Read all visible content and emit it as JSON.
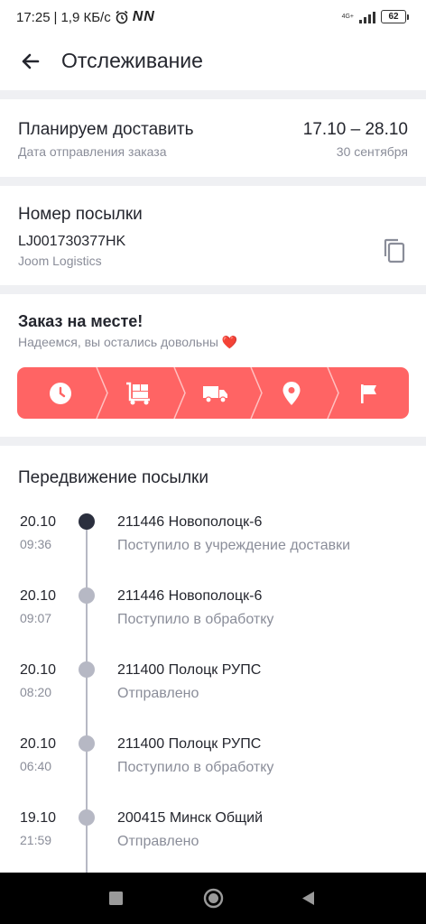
{
  "status_bar": {
    "time": "17:25",
    "speed": "1,9 КБ/с",
    "carrier_badge": "NN",
    "network": "4G+",
    "battery": "62",
    "icons": [
      "alarm-icon",
      "signal-icon",
      "battery-icon"
    ]
  },
  "header": {
    "title": "Отслеживание",
    "back_icon": "arrow-left-icon"
  },
  "delivery": {
    "label": "Планируем доставить",
    "sub_label": "Дата отправления заказа",
    "dates": "17.10 – 28.10",
    "sent_date": "30 сентября"
  },
  "parcel": {
    "label": "Номер посылки",
    "number": "LJ001730377HK",
    "carrier": "Joom Logistics",
    "copy_icon": "copy-icon"
  },
  "order_status": {
    "title": "Заказ на месте!",
    "subtitle": "Надеемся, вы остались довольны ❤️",
    "accent_color": "#ff6464",
    "steps": [
      "clock-icon",
      "dolly-icon",
      "truck-icon",
      "location-pin-icon",
      "flag-icon"
    ]
  },
  "movements": {
    "title": "Передвижение посылки",
    "events": [
      {
        "date": "20.10",
        "time": "09:36",
        "place": "211446 Новополоцк-6",
        "status": "Поступило в учреждение доставки",
        "active": true
      },
      {
        "date": "20.10",
        "time": "09:07",
        "place": "211446 Новополоцк-6",
        "status": "Поступило в обработку",
        "active": false
      },
      {
        "date": "20.10",
        "time": "08:20",
        "place": "211400 Полоцк РУПС",
        "status": "Отправлено",
        "active": false
      },
      {
        "date": "20.10",
        "time": "06:40",
        "place": "211400 Полоцк РУПС",
        "status": "Поступило в обработку",
        "active": false
      },
      {
        "date": "19.10",
        "time": "21:59",
        "place": "200415 Минск Общий",
        "status": "Отправлено",
        "active": false
      }
    ]
  },
  "nav_bar": {
    "icons": [
      "square-icon",
      "circle-home-icon",
      "triangle-back-icon"
    ]
  }
}
